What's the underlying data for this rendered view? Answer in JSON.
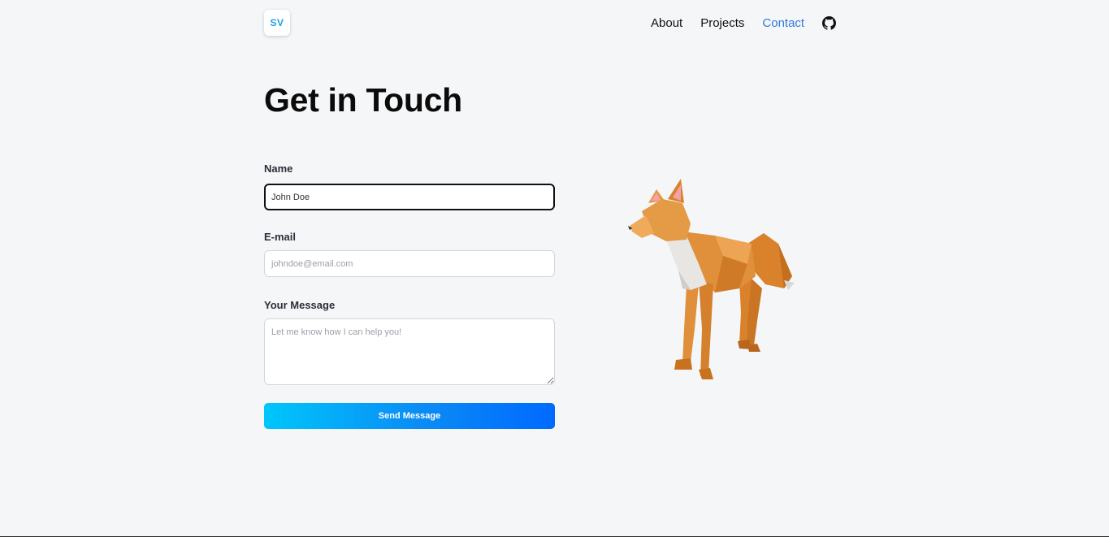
{
  "header": {
    "logo_text": "SV",
    "nav": [
      {
        "label": "About"
      },
      {
        "label": "Projects"
      },
      {
        "label": "Contact"
      }
    ],
    "github_icon": "github-icon"
  },
  "main": {
    "title": "Get in Touch",
    "form": {
      "name_label": "Name",
      "name_value": "John Doe",
      "email_label": "E-mail",
      "email_placeholder": "johndoe@email.com",
      "message_label": "Your Message",
      "message_placeholder": "Let me know how I can help you!",
      "submit_label": "Send Message"
    }
  },
  "colors": {
    "accent": "#2d7be0",
    "button_gradient_start": "#00c6fb",
    "button_gradient_end": "#0069ff",
    "background": "#f5f6f8"
  }
}
